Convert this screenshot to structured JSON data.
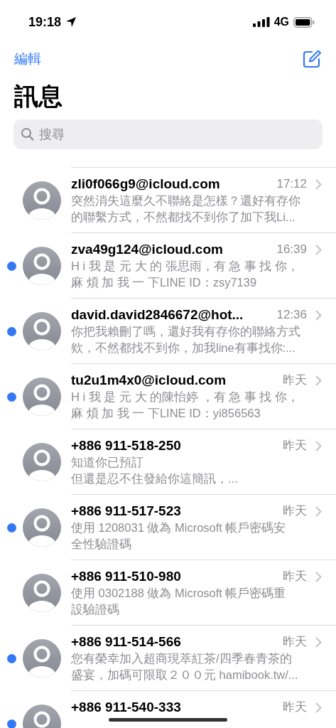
{
  "status_bar": {
    "time": "19:18",
    "network": "4G"
  },
  "nav": {
    "edit": "編輯",
    "title": "訊息"
  },
  "search": {
    "placeholder": "搜尋"
  },
  "conversations": [
    {
      "sender": "zli0f066g9@icloud.com",
      "time": "17:12",
      "unread": false,
      "preview": [
        "突然消失這麼久不聯絡是怎樣？還好有存你",
        "的聯繫方式，不然都找不到你了加下我Li..."
      ]
    },
    {
      "sender": "zva49g124@icloud.com",
      "time": "16:39",
      "unread": true,
      "preview": [
        "H i 我 是 元 大 的 張思雨，有 急 事 找 你，",
        "麻 煩 加 我 一 下LINE ID：zsy7139"
      ]
    },
    {
      "sender": "david.david2846672@hot...",
      "time": "12:36",
      "unread": true,
      "preview": [
        "你把我賴刪了嗎，還好我有存你的聯絡方式",
        "欸，不然都找不到你，加我line有事找你:..."
      ]
    },
    {
      "sender": "tu2u1m4x0@icloud.com",
      "time": "昨天",
      "unread": true,
      "preview": [
        "H i 我 是 元 大 的陳怡婷 ，有 急 事 找 你，",
        "麻 煩 加 我 一 下LINE ID：yi856563"
      ]
    },
    {
      "sender": "+886 911-518-250",
      "time": "昨天",
      "unread": false,
      "preview": [
        "知道你已預訂",
        "但還是忍不住發給你這簡訊，..."
      ]
    },
    {
      "sender": "+886 911-517-523",
      "time": "昨天",
      "unread": true,
      "preview": [
        "使用 1208031 做為 Microsoft 帳戶密碼安",
        "全性驗證碼"
      ]
    },
    {
      "sender": "+886 911-510-980",
      "time": "昨天",
      "unread": false,
      "preview": [
        "使用 0302188 做為 Microsoft 帳戶密碼重",
        "設驗證碼"
      ]
    },
    {
      "sender": "+886 911-514-566",
      "time": "昨天",
      "unread": true,
      "preview": [
        "您有榮幸加入超商現萃紅茶/四季春青茶的",
        "盛宴，加碼可限取２００元 hamibook.tw/..."
      ]
    },
    {
      "sender": "+886 911-540-333",
      "time": "昨天",
      "unread": true
    }
  ]
}
